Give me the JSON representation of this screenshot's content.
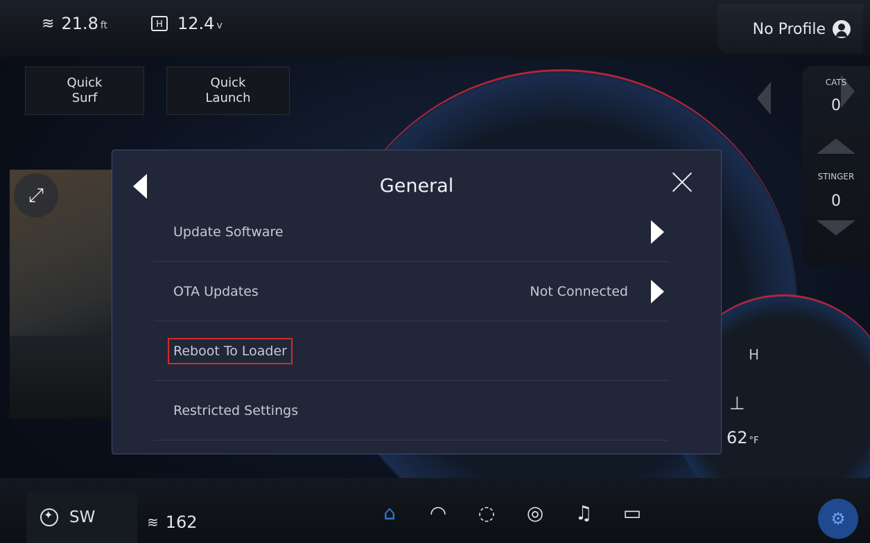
{
  "topbar": {
    "depth_value": "21.8",
    "depth_unit": "ft",
    "battery_value": "12.4",
    "battery_unit": "v",
    "profile_label": "No Profile"
  },
  "quick": {
    "surf_line1": "Quick",
    "surf_line2": "Surf",
    "launch_line1": "Quick",
    "launch_line2": "Launch"
  },
  "side": {
    "cats_label": "CATS",
    "cats_value": "0",
    "stinger_label": "STINGER",
    "stinger_value": "0"
  },
  "gauge": {
    "h_label": "H",
    "temp_value": "62",
    "temp_unit": "°F"
  },
  "bottom": {
    "heading": "SW",
    "depth": "162"
  },
  "modal": {
    "title": "General",
    "rows": [
      {
        "label": "Update Software",
        "status": ""
      },
      {
        "label": "OTA Updates",
        "status": "Not Connected"
      },
      {
        "label": "Reboot To Loader",
        "status": ""
      },
      {
        "label": "Restricted Settings",
        "status": ""
      }
    ]
  },
  "colors": {
    "accent": "#2f79d4",
    "highlight": "#d42b2b",
    "modal_bg": "#212739"
  }
}
